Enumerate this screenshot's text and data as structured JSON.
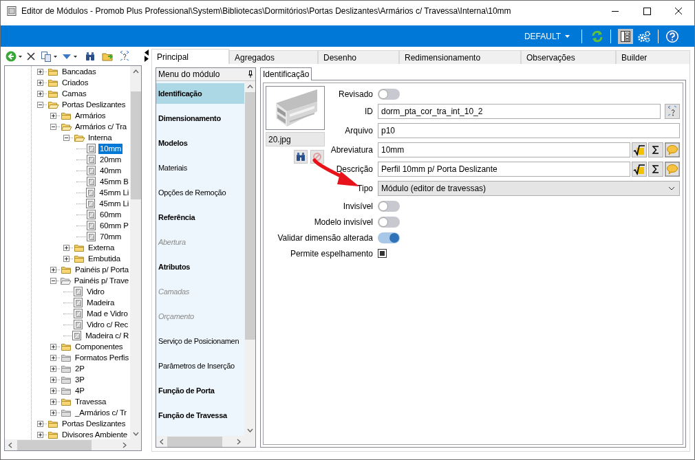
{
  "window": {
    "title": "Editor de Módulos - Promob Plus Professional\\System\\Bibliotecas\\Dormitórios\\Portas Deslizantes\\Armários c/ Travessa\\Interna\\10mm"
  },
  "top_bar": {
    "profile": "DEFAULT",
    "layout_toggle_on": true
  },
  "tree": [
    {
      "kind": "folder",
      "label": "Bancadas",
      "expanded": false,
      "dimmed": false,
      "selected": false
    },
    {
      "kind": "folder",
      "label": "Criados",
      "expanded": false,
      "dimmed": false,
      "selected": false
    },
    {
      "kind": "folder",
      "label": "Camas",
      "expanded": false,
      "dimmed": false,
      "selected": false
    },
    {
      "kind": "folder",
      "label": "Portas Deslizantes",
      "expanded": true,
      "dimmed": false,
      "selected": false,
      "children": [
        {
          "kind": "folder",
          "label": "Armários",
          "expanded": false,
          "dimmed": false,
          "selected": false
        },
        {
          "kind": "folder",
          "label": "Armários c/ Tra",
          "expanded": true,
          "dimmed": false,
          "selected": false,
          "children": [
            {
              "kind": "folder",
              "label": "Interna",
              "expanded": true,
              "dimmed": false,
              "selected": false,
              "children": [
                {
                  "kind": "module",
                  "label": "10mm",
                  "selected": true
                },
                {
                  "kind": "module",
                  "label": "20mm",
                  "selected": false
                },
                {
                  "kind": "module",
                  "label": "40mm",
                  "selected": false
                },
                {
                  "kind": "module",
                  "label": "45mm B",
                  "selected": false
                },
                {
                  "kind": "module",
                  "label": "45mm Li",
                  "selected": false
                },
                {
                  "kind": "module",
                  "label": "45mm Li",
                  "selected": false
                },
                {
                  "kind": "module",
                  "label": "60mm",
                  "selected": false
                },
                {
                  "kind": "module",
                  "label": "60mm P",
                  "selected": false
                },
                {
                  "kind": "module",
                  "label": "70mm",
                  "selected": false
                }
              ]
            },
            {
              "kind": "folder",
              "label": "Externa",
              "expanded": false,
              "dimmed": false,
              "selected": false
            },
            {
              "kind": "folder",
              "label": "Embutida",
              "expanded": false,
              "dimmed": false,
              "selected": false
            }
          ]
        },
        {
          "kind": "folder",
          "label": "Painéis p/ Porta",
          "expanded": false,
          "dimmed": false,
          "selected": false
        },
        {
          "kind": "folder",
          "label": "Painéis p/ Trave",
          "expanded": true,
          "dimmed": true,
          "selected": false,
          "children": [
            {
              "kind": "module",
              "label": "Vidro",
              "selected": false
            },
            {
              "kind": "module",
              "label": "Madeira",
              "selected": false
            },
            {
              "kind": "module",
              "label": "Mad e Vidro",
              "selected": false
            },
            {
              "kind": "module",
              "label": "Vidro c/ Rec",
              "selected": false
            },
            {
              "kind": "module",
              "label": "Madeira c/ R",
              "selected": false
            }
          ]
        },
        {
          "kind": "folder",
          "label": "Componentes",
          "expanded": false,
          "dimmed": false,
          "selected": false
        },
        {
          "kind": "folder",
          "label": "Formatos Perfis",
          "expanded": false,
          "dimmed": true,
          "selected": false
        },
        {
          "kind": "folder",
          "label": "2P",
          "expanded": false,
          "dimmed": true,
          "selected": false
        },
        {
          "kind": "folder",
          "label": "3P",
          "expanded": false,
          "dimmed": true,
          "selected": false
        },
        {
          "kind": "folder",
          "label": "4P",
          "expanded": false,
          "dimmed": true,
          "selected": false
        },
        {
          "kind": "folder",
          "label": "Travessa",
          "expanded": false,
          "dimmed": false,
          "selected": false
        },
        {
          "kind": "folder",
          "label": "_Armários c/ Tr",
          "expanded": false,
          "dimmed": true,
          "selected": false
        }
      ]
    },
    {
      "kind": "folder",
      "label": "Portas Deslizantes",
      "expanded": false,
      "dimmed": false,
      "selected": false
    },
    {
      "kind": "folder",
      "label": "Divisores Ambiente",
      "expanded": false,
      "dimmed": false,
      "selected": false
    }
  ],
  "tabs": [
    {
      "label": "Principal",
      "selected": true
    },
    {
      "label": "Agregados",
      "selected": false
    },
    {
      "label": "Desenho",
      "selected": false
    },
    {
      "label": "Redimensionamento",
      "selected": false
    },
    {
      "label": "Observações",
      "selected": false
    },
    {
      "label": "Builder",
      "selected": false
    }
  ],
  "module_menu": {
    "title": "Menu do módulo",
    "items": [
      {
        "label": "Identificação",
        "bold": true,
        "disabled": false,
        "selected": true
      },
      {
        "label": "Dimensionamento",
        "bold": true,
        "disabled": false,
        "selected": false
      },
      {
        "label": "Modelos",
        "bold": true,
        "disabled": false,
        "selected": false
      },
      {
        "label": "Materiais",
        "bold": false,
        "disabled": false,
        "selected": false
      },
      {
        "label": "Opções de Remoção",
        "bold": false,
        "disabled": false,
        "selected": false
      },
      {
        "label": "Referência",
        "bold": true,
        "disabled": false,
        "selected": false
      },
      {
        "label": "Abertura",
        "bold": false,
        "disabled": true,
        "selected": false
      },
      {
        "label": "Atributos",
        "bold": true,
        "disabled": false,
        "selected": false
      },
      {
        "label": "Camadas",
        "bold": false,
        "disabled": true,
        "selected": false
      },
      {
        "label": "Orçamento",
        "bold": false,
        "disabled": true,
        "selected": false
      },
      {
        "label": "Serviço de Posicionamen",
        "bold": false,
        "disabled": false,
        "selected": false
      },
      {
        "label": "Parâmetros de Inserção",
        "bold": false,
        "disabled": false,
        "selected": false
      },
      {
        "label": "Função de Porta",
        "bold": true,
        "disabled": false,
        "selected": false
      },
      {
        "label": "Função de Travessa",
        "bold": true,
        "disabled": false,
        "selected": false
      }
    ]
  },
  "subtabs": [
    {
      "label": "Identificação",
      "selected": true
    }
  ],
  "form": {
    "image_caption": "20.jpg",
    "fields": [
      {
        "kind": "toggle",
        "label": "Revisado",
        "on": false
      },
      {
        "kind": "text_picker",
        "label": "ID",
        "value": "dorm_pta_cor_tra_int_10_2"
      },
      {
        "kind": "text",
        "label": "Arquivo",
        "value": "p10"
      },
      {
        "kind": "text_formula",
        "label": "Abreviatura",
        "value": "10mm"
      },
      {
        "kind": "text_formula",
        "label": "Descrição",
        "value": "Perfil 10mm p/ Porta Deslizante"
      },
      {
        "kind": "select",
        "label": "Tipo",
        "value": "Módulo (editor de travessas)"
      },
      {
        "kind": "toggle",
        "label": "Invisível",
        "on": false
      },
      {
        "kind": "toggle",
        "label": "Modelo invisível",
        "on": false
      },
      {
        "kind": "toggle",
        "label": "Validar dimensão alterada",
        "on": true
      },
      {
        "kind": "checkbox",
        "label": "Permite espelhamento",
        "checked": true
      }
    ]
  }
}
